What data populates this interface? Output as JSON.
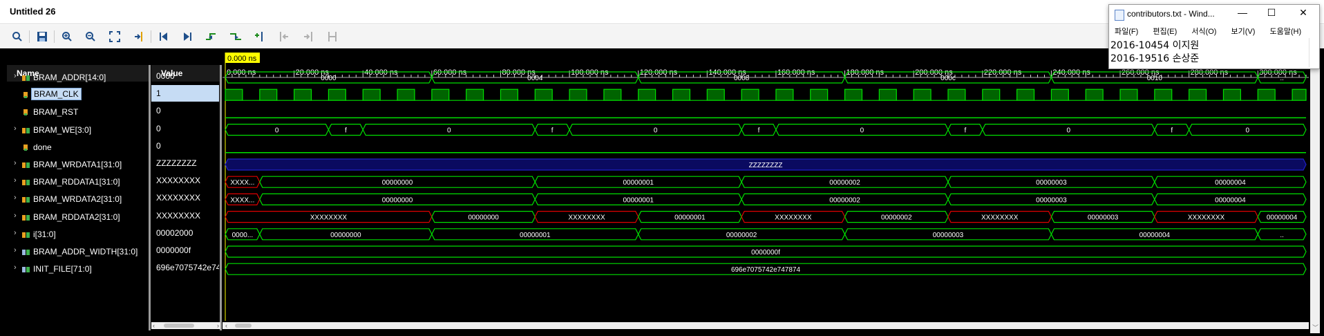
{
  "window": {
    "title": "Untitled 26"
  },
  "toolbar": {
    "icons": [
      "search-icon",
      "save-icon",
      "zoom-in-icon",
      "zoom-out-icon",
      "zoom-fit-icon",
      "go-to-cursor-icon",
      "go-to-start-icon",
      "go-to-end-icon",
      "previous-transition-icon",
      "next-transition-icon",
      "add-marker-icon",
      "previous-marker-icon",
      "next-marker-icon",
      "swap-cursors-icon"
    ]
  },
  "cursor": {
    "label": "0.000 ns"
  },
  "columns": {
    "name": "Name",
    "value": "Value"
  },
  "signals": [
    {
      "name": "BRAM_ADDR[14:0]",
      "value": "0000",
      "expandable": true,
      "type": "bus"
    },
    {
      "name": "BRAM_CLK",
      "value": "1",
      "expandable": false,
      "type": "bit",
      "selected": true
    },
    {
      "name": "BRAM_RST",
      "value": "0",
      "expandable": false,
      "type": "bit"
    },
    {
      "name": "BRAM_WE[3:0]",
      "value": "0",
      "expandable": true,
      "type": "bus"
    },
    {
      "name": "done",
      "value": "0",
      "expandable": false,
      "type": "bit"
    },
    {
      "name": "BRAM_WRDATA1[31:0]",
      "value": "ZZZZZZZZ",
      "expandable": true,
      "type": "bus"
    },
    {
      "name": "BRAM_RDDATA1[31:0]",
      "value": "XXXXXXXX",
      "expandable": true,
      "type": "bus"
    },
    {
      "name": "BRAM_WRDATA2[31:0]",
      "value": "XXXXXXXX",
      "expandable": true,
      "type": "bus"
    },
    {
      "name": "BRAM_RDDATA2[31:0]",
      "value": "XXXXXXXX",
      "expandable": true,
      "type": "bus"
    },
    {
      "name": "i[31:0]",
      "value": "00002000",
      "expandable": true,
      "type": "bus"
    },
    {
      "name": "BRAM_ADDR_WIDTH[31:0]",
      "value": "0000000f",
      "expandable": true,
      "type": "param"
    },
    {
      "name": "INIT_FILE[71:0]",
      "value": "696e7075742e74",
      "expandable": true,
      "type": "param"
    }
  ],
  "time_axis": {
    "ticks": [
      "0.000 ns",
      "20.000 ns",
      "40.000 ns",
      "60.000 ns",
      "80.000 ns",
      "100.000 ns",
      "120.000 ns",
      "140.000 ns",
      "160.000 ns",
      "180.000 ns",
      "200.000 ns",
      "220.000 ns",
      "240.000 ns",
      "260.000 ns",
      "280.000 ns",
      "300.000 ns"
    ],
    "range_ns": [
      0,
      314
    ]
  },
  "waveforms": {
    "clock_period_ns": 10,
    "addr": [
      {
        "from": 0,
        "to": 60,
        "label": "0000"
      },
      {
        "from": 60,
        "to": 120,
        "label": "0004"
      },
      {
        "from": 120,
        "to": 180,
        "label": "0008"
      },
      {
        "from": 180,
        "to": 240,
        "label": "000c"
      },
      {
        "from": 240,
        "to": 300,
        "label": "0010"
      },
      {
        "from": 300,
        "to": 314,
        "label": ".."
      }
    ],
    "we": [
      {
        "from": 0,
        "to": 30,
        "label": "0"
      },
      {
        "from": 30,
        "to": 40,
        "label": "f"
      },
      {
        "from": 40,
        "to": 90,
        "label": "0"
      },
      {
        "from": 90,
        "to": 100,
        "label": "f"
      },
      {
        "from": 100,
        "to": 150,
        "label": "0"
      },
      {
        "from": 150,
        "to": 160,
        "label": "f"
      },
      {
        "from": 160,
        "to": 210,
        "label": "0"
      },
      {
        "from": 210,
        "to": 220,
        "label": "f"
      },
      {
        "from": 220,
        "to": 270,
        "label": "0"
      },
      {
        "from": 270,
        "to": 280,
        "label": "f"
      },
      {
        "from": 280,
        "to": 314,
        "label": "0"
      }
    ],
    "wrdata1": [
      {
        "from": 0,
        "to": 314,
        "label": "ZZZZZZZZ",
        "z": true
      }
    ],
    "rddata1": [
      {
        "from": 0,
        "to": 10,
        "label": "XXXX...",
        "x": true
      },
      {
        "from": 10,
        "to": 90,
        "label": "00000000"
      },
      {
        "from": 90,
        "to": 150,
        "label": "00000001"
      },
      {
        "from": 150,
        "to": 210,
        "label": "00000002"
      },
      {
        "from": 210,
        "to": 270,
        "label": "00000003"
      },
      {
        "from": 270,
        "to": 314,
        "label": "00000004"
      }
    ],
    "wrdata2": [
      {
        "from": 0,
        "to": 10,
        "label": "XXXX...",
        "x": true
      },
      {
        "from": 10,
        "to": 90,
        "label": "00000000"
      },
      {
        "from": 90,
        "to": 150,
        "label": "00000001"
      },
      {
        "from": 150,
        "to": 210,
        "label": "00000002"
      },
      {
        "from": 210,
        "to": 270,
        "label": "00000003"
      },
      {
        "from": 270,
        "to": 314,
        "label": "00000004"
      }
    ],
    "rddata2": [
      {
        "from": 0,
        "to": 60,
        "label": "XXXXXXXX",
        "x": true
      },
      {
        "from": 60,
        "to": 90,
        "label": "00000000"
      },
      {
        "from": 90,
        "to": 120,
        "label": "XXXXXXXX",
        "x": true
      },
      {
        "from": 120,
        "to": 150,
        "label": "00000001"
      },
      {
        "from": 150,
        "to": 180,
        "label": "XXXXXXXX",
        "x": true
      },
      {
        "from": 180,
        "to": 210,
        "label": "00000002"
      },
      {
        "from": 210,
        "to": 240,
        "label": "XXXXXXXX",
        "x": true
      },
      {
        "from": 240,
        "to": 270,
        "label": "00000003"
      },
      {
        "from": 270,
        "to": 300,
        "label": "XXXXXXXX",
        "x": true
      },
      {
        "from": 300,
        "to": 314,
        "label": "00000004"
      }
    ],
    "i": [
      {
        "from": 0,
        "to": 10,
        "label": "0000..."
      },
      {
        "from": 10,
        "to": 60,
        "label": "00000000"
      },
      {
        "from": 60,
        "to": 120,
        "label": "00000001"
      },
      {
        "from": 120,
        "to": 180,
        "label": "00000002"
      },
      {
        "from": 180,
        "to": 240,
        "label": "00000003"
      },
      {
        "from": 240,
        "to": 300,
        "label": "00000004"
      },
      {
        "from": 300,
        "to": 314,
        "label": ".."
      }
    ],
    "addr_width": [
      {
        "from": 0,
        "to": 314,
        "label": "0000000f"
      }
    ],
    "init_file": [
      {
        "from": 0,
        "to": 314,
        "label": "696e7075742e747874"
      }
    ]
  },
  "colors": {
    "wave": "#00e000",
    "x_state": "#e00000",
    "z_state": "#2020c8",
    "cursor": "#ffff00",
    "background": "#000000"
  },
  "notepad": {
    "title": "contributors.txt - Wind...",
    "menu": [
      "파일(F)",
      "편집(E)",
      "서식(O)",
      "보기(V)",
      "도움말(H)"
    ],
    "lines": [
      "2016-10454 이지원",
      "2016-19516 손상준"
    ],
    "buttons": {
      "minimize": "—",
      "maximize": "☐",
      "close": "✕"
    }
  }
}
